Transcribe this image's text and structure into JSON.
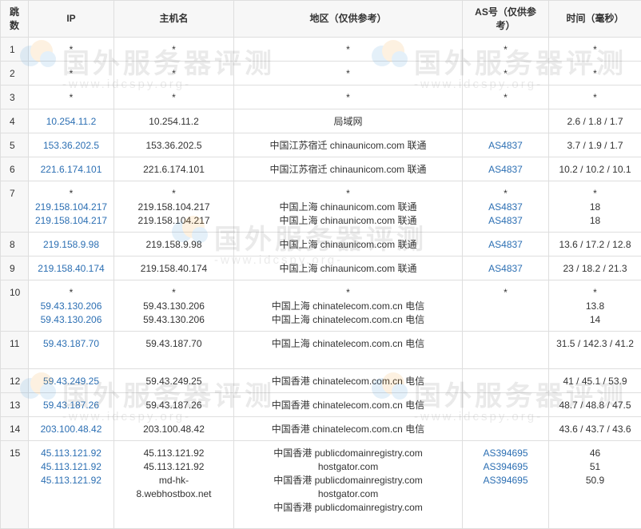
{
  "columns": [
    "跳数",
    "IP",
    "主机名",
    "地区（仅供参考）",
    "AS号（仅供参考）",
    "时间（毫秒）"
  ],
  "rows": [
    {
      "hop": "1",
      "ip": [
        "*"
      ],
      "host": [
        "*"
      ],
      "region": [
        "*"
      ],
      "as": [
        "*"
      ],
      "time": [
        "*"
      ],
      "h": 30
    },
    {
      "hop": "2",
      "ip": [
        "*"
      ],
      "host": [
        "*"
      ],
      "region": [
        "*"
      ],
      "as": [
        "*"
      ],
      "time": [
        "*"
      ],
      "h": 30
    },
    {
      "hop": "3",
      "ip": [
        "*"
      ],
      "host": [
        "*"
      ],
      "region": [
        "*"
      ],
      "as": [
        "*"
      ],
      "time": [
        "*"
      ],
      "h": 30
    },
    {
      "hop": "4",
      "ip": [
        "10.254.11.2"
      ],
      "host": [
        "10.254.11.2"
      ],
      "region": [
        "局域网"
      ],
      "as": [],
      "time": [
        "2.6 / 1.8 / 1.7"
      ],
      "h": 30
    },
    {
      "hop": "5",
      "ip": [
        "153.36.202.5"
      ],
      "host": [
        "153.36.202.5"
      ],
      "region": [
        "中国江苏宿迁 chinaunicom.com 联通"
      ],
      "as": [
        "AS4837"
      ],
      "time": [
        "3.7 / 1.9 / 1.7"
      ],
      "h": 30
    },
    {
      "hop": "6",
      "ip": [
        "221.6.174.101"
      ],
      "host": [
        "221.6.174.101"
      ],
      "region": [
        "中国江苏宿迁 chinaunicom.com 联通"
      ],
      "as": [
        "AS4837"
      ],
      "time": [
        "10.2 / 10.2 / 10.1"
      ],
      "h": 30
    },
    {
      "hop": "7",
      "ip": [
        "*",
        "219.158.104.217",
        "219.158.104.217"
      ],
      "host": [
        "*",
        "219.158.104.217",
        "219.158.104.217"
      ],
      "region": [
        "*",
        "中国上海 chinaunicom.com 联通",
        "中国上海 chinaunicom.com 联通"
      ],
      "as": [
        "*",
        "AS4837",
        "AS4837"
      ],
      "time": [
        "*",
        "18",
        "18"
      ],
      "h": 64
    },
    {
      "hop": "8",
      "ip": [
        "219.158.9.98"
      ],
      "host": [
        "219.158.9.98"
      ],
      "region": [
        "中国上海 chinaunicom.com 联通"
      ],
      "as": [
        "AS4837"
      ],
      "time": [
        "13.6 / 17.2 / 12.8"
      ],
      "h": 30
    },
    {
      "hop": "9",
      "ip": [
        "219.158.40.174"
      ],
      "host": [
        "219.158.40.174"
      ],
      "region": [
        "中国上海 chinaunicom.com 联通"
      ],
      "as": [
        "AS4837"
      ],
      "time": [
        "23 / 18.2 / 21.3"
      ],
      "h": 30
    },
    {
      "hop": "10",
      "ip": [
        "*",
        "59.43.130.206",
        "59.43.130.206"
      ],
      "host": [
        "*",
        "59.43.130.206",
        "59.43.130.206"
      ],
      "region": [
        "*",
        "中国上海 chinatelecom.com.cn 电信",
        "中国上海 chinatelecom.com.cn 电信"
      ],
      "as": [
        "*"
      ],
      "time": [
        "*",
        "13.8",
        "14"
      ],
      "h": 64
    },
    {
      "hop": "11",
      "ip": [
        "59.43.187.70"
      ],
      "host": [
        "59.43.187.70"
      ],
      "region": [
        "中国上海 chinatelecom.com.cn 电信"
      ],
      "as": [],
      "time": [
        "31.5 / 142.3 / 41.2"
      ],
      "h": 47,
      "wrapTime": true
    },
    {
      "hop": "12",
      "ip": [
        "59.43.249.25"
      ],
      "host": [
        "59.43.249.25"
      ],
      "region": [
        "中国香港 chinatelecom.com.cn 电信"
      ],
      "as": [],
      "time": [
        "41 / 45.1 / 53.9"
      ],
      "h": 30
    },
    {
      "hop": "13",
      "ip": [
        "59.43.187.26"
      ],
      "host": [
        "59.43.187.26"
      ],
      "region": [
        "中国香港 chinatelecom.com.cn 电信"
      ],
      "as": [],
      "time": [
        "48.7 / 48.8 / 47.5"
      ],
      "h": 30
    },
    {
      "hop": "14",
      "ip": [
        "203.100.48.42"
      ],
      "host": [
        "203.100.48.42"
      ],
      "region": [
        "中国香港 chinatelecom.com.cn 电信"
      ],
      "as": [],
      "time": [
        "43.6 / 43.7 / 43.6"
      ],
      "h": 30
    },
    {
      "hop": "15",
      "ip": [
        "45.113.121.92",
        "45.113.121.92",
        "45.113.121.92"
      ],
      "host": [
        "45.113.121.92",
        "45.113.121.92",
        "md-hk-",
        "8.webhostbox.net"
      ],
      "region": [
        "中国香港 publicdomainregistry.com",
        "hostgator.com",
        "中国香港 publicdomainregistry.com",
        "hostgator.com",
        "中国香港 publicdomainregistry.com"
      ],
      "as": [
        "AS394695",
        "AS394695",
        "AS394695"
      ],
      "time": [
        "46",
        "51",
        "50.9"
      ],
      "h": 110
    }
  ],
  "watermark": {
    "title": "国外服务器评测",
    "url": "-www.idcspy.org-"
  },
  "colors": {
    "link": "#2c6fb3",
    "header_bg": "#f7f7f7",
    "border": "#dedede"
  }
}
